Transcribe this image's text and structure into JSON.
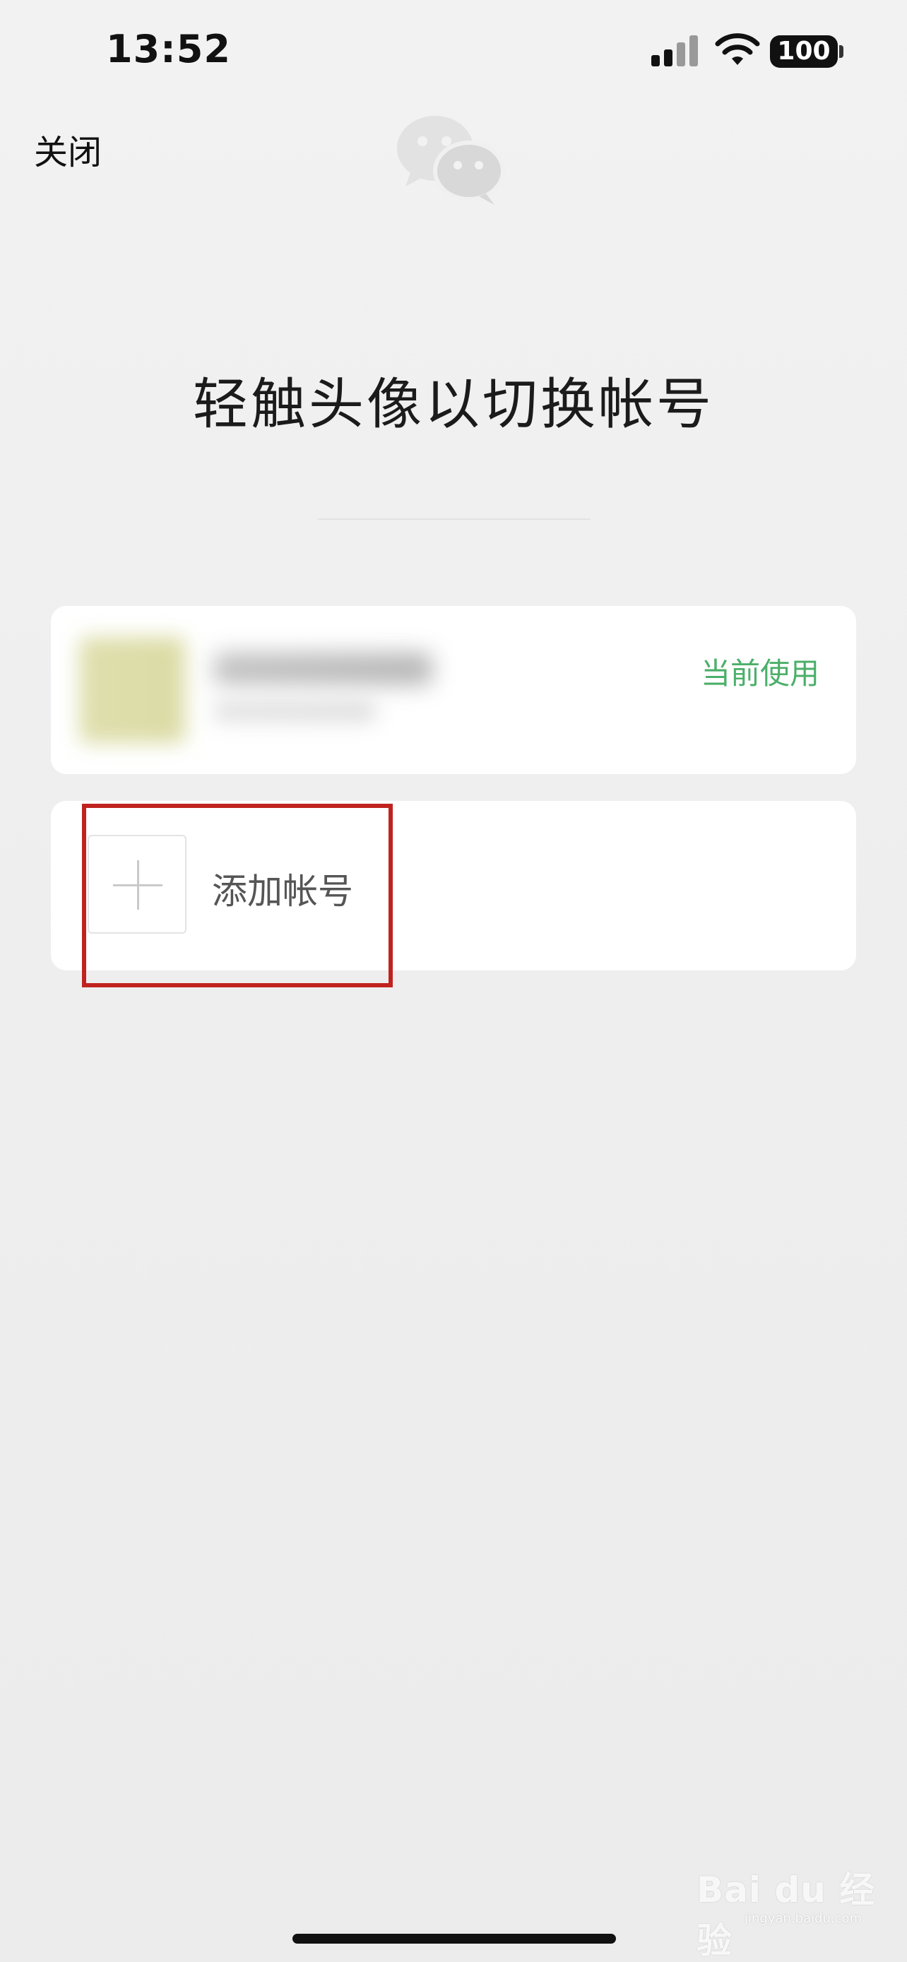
{
  "status_bar": {
    "time": "13:52",
    "battery": "100"
  },
  "header": {
    "close_label": "关闭"
  },
  "main": {
    "title": "轻触头像以切换帐号",
    "accounts": [
      {
        "status": "当前使用"
      }
    ],
    "add_account_label": "添加帐号"
  },
  "watermark": {
    "brand": "Bai du 经验",
    "site": "jingyan.baidu.com"
  },
  "colors": {
    "current_tag": "#4caf6a",
    "highlight": "#c0231f"
  }
}
